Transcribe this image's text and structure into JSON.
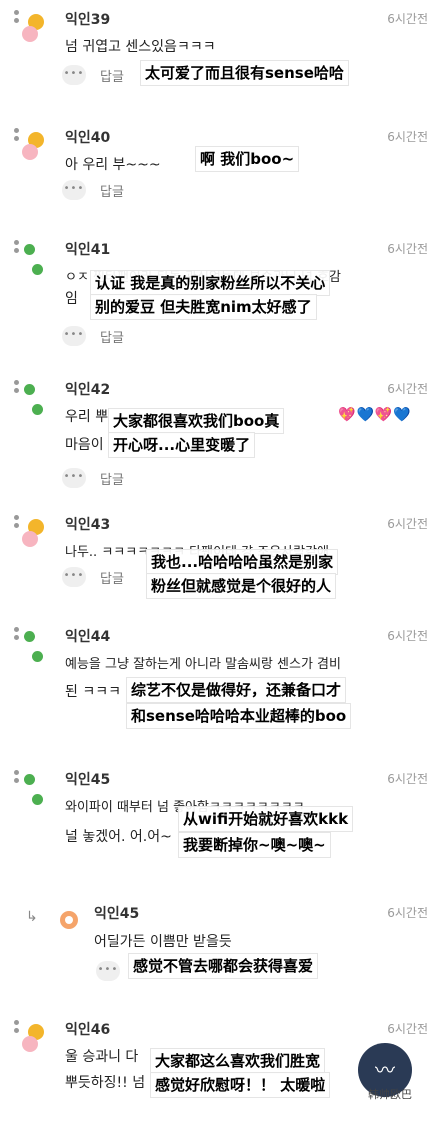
{
  "ui": {
    "more_dots": "•••",
    "reply_label": "답글"
  },
  "comments": [
    {
      "name": "익인39",
      "time": "6시간전",
      "line1": "넘 귀엽고 센스있음ㅋㅋㅋ",
      "line2": "",
      "subtitle": [
        "太可爱了而且很有sense哈哈"
      ]
    },
    {
      "name": "익인40",
      "time": "6시간전",
      "line1": "아 우리 부~~~",
      "line2": "",
      "subtitle": [
        "啊 我们boo~"
      ]
    },
    {
      "name": "익인41",
      "time": "6시간전",
      "line1": "ㅇㅈ 찐타팬이라 타돌 관심없는데 부승관님 넘 호감",
      "line2": "임",
      "subtitle": [
        "认证 我是真的别家粉丝所以不关心",
        "别的爱豆 但夫胜宽nim太好感了"
      ]
    },
    {
      "name": "익인42",
      "time": "6시간전",
      "line1": "우리 뿌",
      "line2": "마음이",
      "subtitle": [
        "大家都很喜欢我们boo真",
        "开心呀...心里变暖了"
      ]
    },
    {
      "name": "익인43",
      "time": "6시간전",
      "line1": "나두.. ㅋㅋㅋㅋㅋㅋㅋ 타팬이데 걍 조은사람같애",
      "line2": "",
      "subtitle": [
        "我也...哈哈哈哈虽然是别家",
        "粉丝但就感觉是个很好的人"
      ]
    },
    {
      "name": "익인44",
      "time": "6시간전",
      "line1": "예능을 그냥 잘하는게 아니라 말솜씨랑 센스가 겸비",
      "line2": "된 ㅋㅋㅋ",
      "subtitle": [
        "综艺不仅是做得好，还兼备口才",
        "和sense哈哈哈本业超棒的boo"
      ]
    },
    {
      "name": "익인45",
      "time": "6시간전",
      "line1": "와이파이 때부터 넘 좋아함ㅋㅋㅋㅋㅋㅋㅋㅋ",
      "line2": "널 놓겠어. 어.어~",
      "subtitle": [
        "从wifi开始就好喜欢kkk",
        "我要断掉你~噢~噢~"
      ]
    },
    {
      "name": "익인45",
      "time": "6시간전",
      "line1": "어딜가든 이쁨만 받을듯",
      "line2": "",
      "subtitle": [
        "感觉不管去哪都会获得喜爱"
      ],
      "reply": true
    },
    {
      "name": "익인46",
      "time": "6시간전",
      "line1": "울 승과니 다",
      "line2": "뿌듯하징!! 넘",
      "subtitle": [
        "大家都这么喜欢我们胜宽",
        "感觉好欣慰呀！！ 太暖啦"
      ]
    }
  ],
  "hearts": [
    "💖",
    "💙",
    "💖",
    "💙"
  ],
  "watermark": {
    "text": "韩帅欧巴"
  }
}
